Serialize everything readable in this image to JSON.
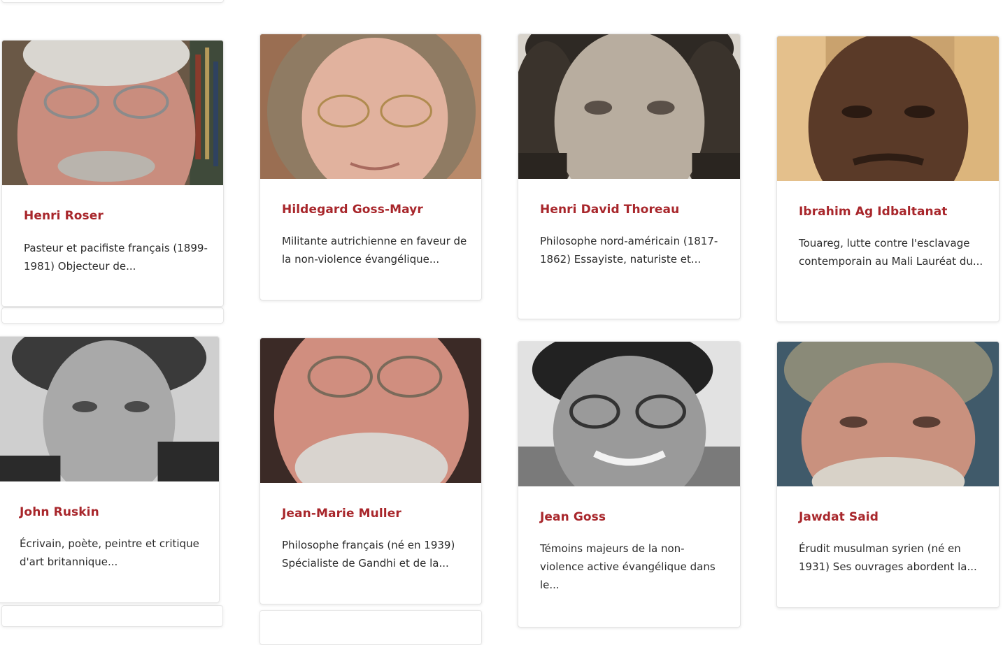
{
  "people": [
    {
      "name": "Henri Roser",
      "description": "Pasteur et pacifiste français (1899-1981) Objecteur de...",
      "photo": "portrait-photo"
    },
    {
      "name": "Hildegard Goss-Mayr",
      "description": "Militante autrichienne en faveur de la non-violence évangélique...",
      "photo": "portrait-photo"
    },
    {
      "name": "Henri David Thoreau",
      "description": "Philosophe nord-américain (1817-1862) Essayiste, naturiste et...",
      "photo": "portrait-photo"
    },
    {
      "name": "Ibrahim Ag Idbaltanat",
      "description": "Touareg, lutte contre l'esclavage contemporain au Mali Lauréat du...",
      "photo": "portrait-photo"
    },
    {
      "name": "John Ruskin",
      "description": "Écrivain, poète, peintre et critique d'art britannique...",
      "photo": "portrait-photo"
    },
    {
      "name": "Jean-Marie Muller",
      "description": "Philosophe français (né en 1939) Spécialiste de Gandhi et de la...",
      "photo": "portrait-photo"
    },
    {
      "name": "Jean Goss",
      "description": "Témoins majeurs de la non-violence active évangélique dans le...",
      "photo": "portrait-photo"
    },
    {
      "name": "Jawdat Said",
      "description": "Érudit musulman syrien (né en 1931) Ses ouvrages abordent la...",
      "photo": "portrait-photo"
    }
  ],
  "colors": {
    "name": "#a8262b",
    "text": "#2b2b2b"
  }
}
